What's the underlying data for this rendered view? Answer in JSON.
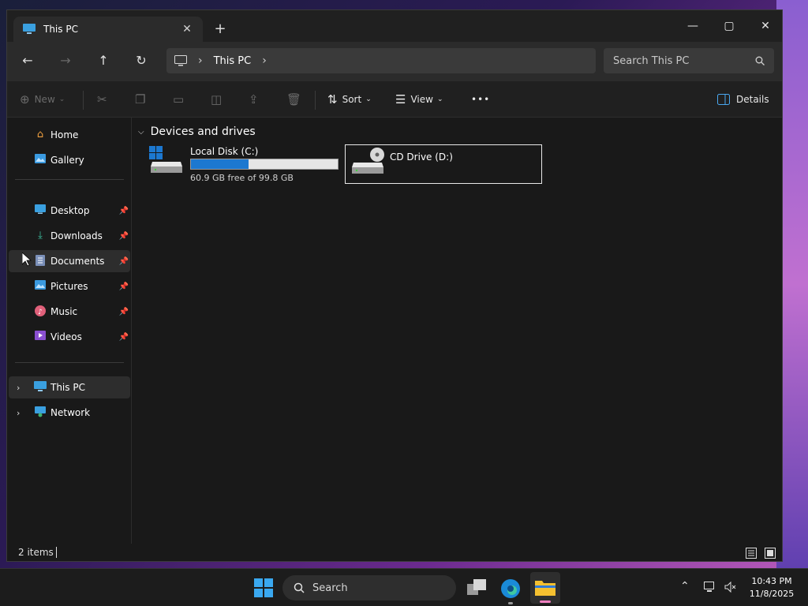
{
  "window": {
    "tab_title": "This PC",
    "tab_close": "✕",
    "new_tab": "+",
    "minimize": "—",
    "maximize": "▢",
    "close": "✕"
  },
  "navigation": {
    "back": "←",
    "forward": "→",
    "up": "↑",
    "refresh": "↻",
    "breadcrumb": [
      "This PC"
    ],
    "breadcrumb_sep": "›",
    "search_placeholder": "Search This PC"
  },
  "command_bar": {
    "new_label": "New",
    "sort_label": "Sort",
    "view_label": "View",
    "more_label": "•••",
    "details_label": "Details"
  },
  "sidebar": {
    "quick": [
      {
        "label": "Home",
        "icon": "home-icon"
      },
      {
        "label": "Gallery",
        "icon": "gallery-icon"
      }
    ],
    "pinned": [
      {
        "label": "Desktop",
        "icon": "desktop-icon"
      },
      {
        "label": "Downloads",
        "icon": "downloads-icon"
      },
      {
        "label": "Documents",
        "icon": "documents-icon"
      },
      {
        "label": "Pictures",
        "icon": "pictures-icon"
      },
      {
        "label": "Music",
        "icon": "music-icon"
      },
      {
        "label": "Videos",
        "icon": "videos-icon"
      }
    ],
    "locations": [
      {
        "label": "This PC",
        "icon": "this-pc-icon"
      },
      {
        "label": "Network",
        "icon": "network-icon"
      }
    ]
  },
  "main": {
    "group_title": "Devices and drives",
    "drives": [
      {
        "name": "Local Disk (C:)",
        "free_text": "60.9 GB free of 99.8 GB",
        "used_fraction": 0.39
      },
      {
        "name": "CD Drive (D:)"
      }
    ]
  },
  "status": {
    "item_count": "2 items"
  },
  "taskbar": {
    "search_label": "Search",
    "time": "10:43 PM",
    "date": "11/8/2025"
  },
  "colors": {
    "accent": "#1c78d0",
    "window_bg": "#191919"
  }
}
